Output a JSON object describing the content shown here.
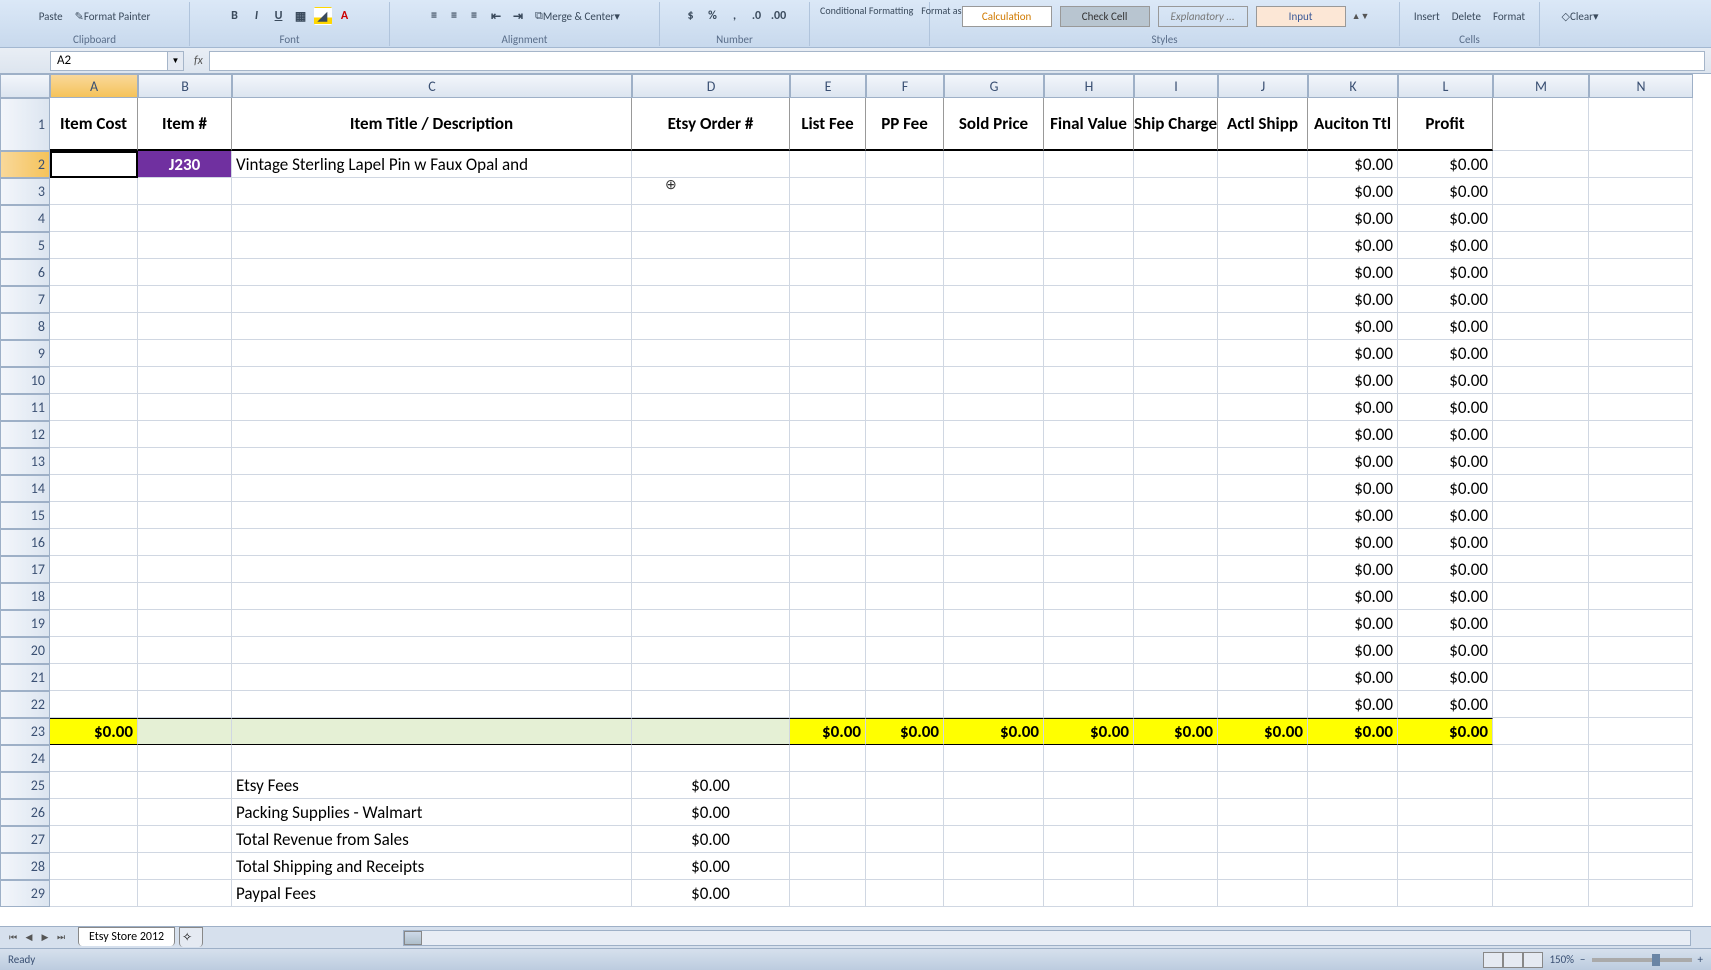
{
  "ribbon": {
    "paste": "Paste",
    "format_painter": "Format Painter",
    "clipboard": "Clipboard",
    "font": "Font",
    "alignment": "Alignment",
    "number": "Number",
    "merge": "Merge & Center",
    "cond_fmt": "Conditional Formatting",
    "fmt_table": "Format as Table",
    "styles": "Styles",
    "calc": "Calculation",
    "check": "Check Cell",
    "explan": "Explanatory ...",
    "input": "Input",
    "insert": "Insert",
    "delete": "Delete",
    "format": "Format",
    "cells": "Cells",
    "clear": "Clear"
  },
  "namebox": "A2",
  "fx": "fx",
  "columns": [
    "A",
    "B",
    "C",
    "D",
    "E",
    "F",
    "G",
    "H",
    "I",
    "J",
    "K",
    "L",
    "M",
    "N"
  ],
  "headers": {
    "A": "Item Cost",
    "B": "Item #",
    "C": "Item Title / Description",
    "D": "Etsy Order #",
    "E": "List Fee",
    "F": "PP Fee",
    "G": "Sold Price",
    "H": "Final Value",
    "I": "Ship Charge",
    "J": "Actl Shipp",
    "K": "Auciton Ttl",
    "L": "Profit"
  },
  "row2": {
    "B": "J230",
    "C": "Vintage Sterling Lapel Pin w Faux Opal and",
    "K": "$0.00",
    "L": "$0.00"
  },
  "zero": "$0.00",
  "totals_row": {
    "A": "$0.00",
    "E": "$0.00",
    "F": "$0.00",
    "G": "$0.00",
    "H": "$0.00",
    "I": "$0.00",
    "J": "$0.00",
    "K": "$0.00",
    "L": "$0.00"
  },
  "summary": [
    {
      "label": "Etsy Fees",
      "value": "$0.00"
    },
    {
      "label": "Packing Supplies - Walmart",
      "value": "$0.00"
    },
    {
      "label": "Total Revenue from Sales",
      "value": "$0.00"
    },
    {
      "label": "Total Shipping and Receipts",
      "value": "$0.00"
    },
    {
      "label": "Paypal Fees",
      "value": "$0.00"
    }
  ],
  "sheet_tab": "Etsy Store 2012",
  "status": "Ready",
  "zoom": "150%"
}
